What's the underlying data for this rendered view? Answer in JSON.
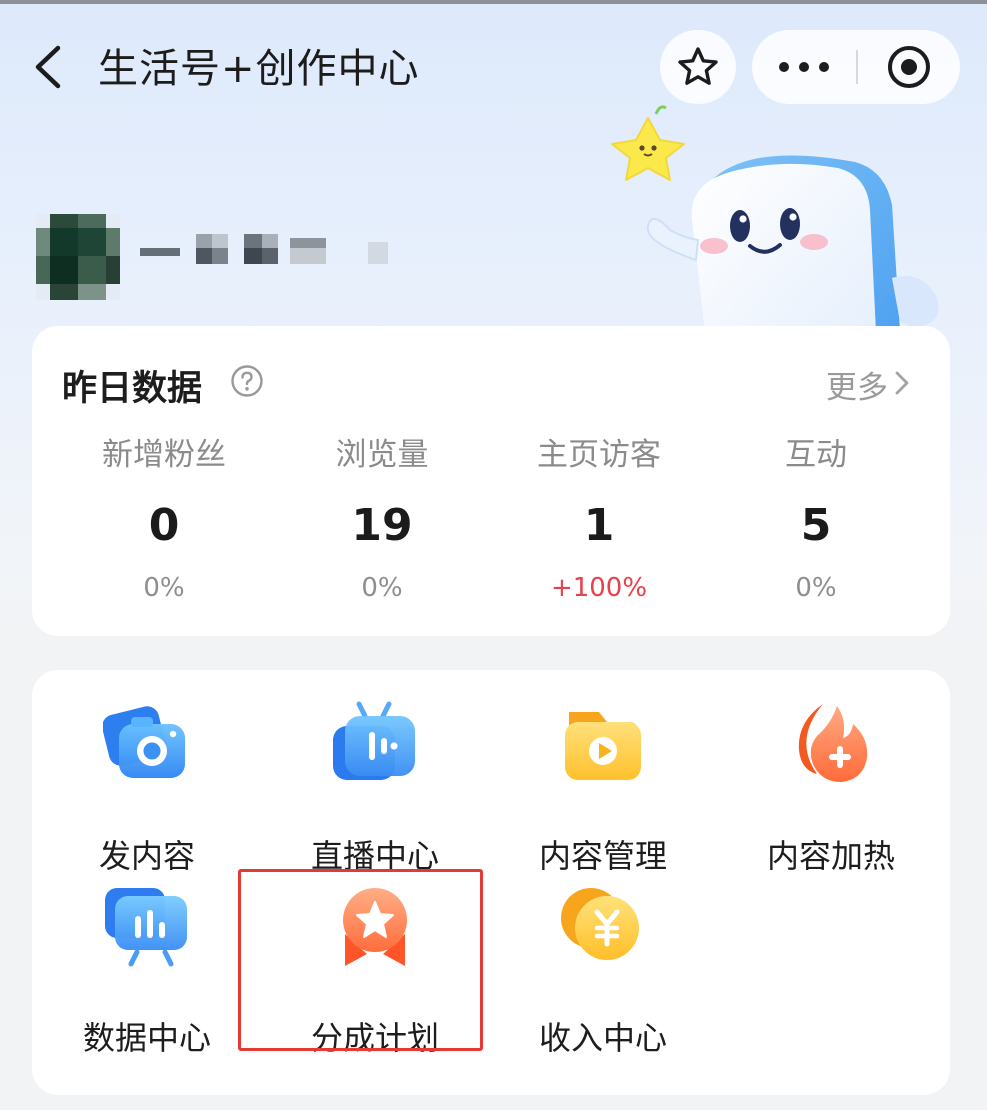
{
  "header": {
    "title": "生活号+创作中心"
  },
  "profile": {
    "name": "一"
  },
  "stats": {
    "title": "昨日数据",
    "more": "更多",
    "items": [
      {
        "label": "新增粉丝",
        "value": "0",
        "change": "0%"
      },
      {
        "label": "浏览量",
        "value": "19",
        "change": "0%"
      },
      {
        "label": "主页访客",
        "value": "1",
        "change": "+100%"
      },
      {
        "label": "互动",
        "value": "5",
        "change": "0%"
      }
    ]
  },
  "tools": [
    {
      "label": "发内容",
      "icon": "camera-icon"
    },
    {
      "label": "直播中心",
      "icon": "live-tv-icon"
    },
    {
      "label": "内容管理",
      "icon": "video-folder-icon"
    },
    {
      "label": "内容加热",
      "icon": "flame-plus-icon"
    },
    {
      "label": "数据中心",
      "icon": "data-chart-icon"
    },
    {
      "label": "分成计划",
      "icon": "medal-icon"
    },
    {
      "label": "收入中心",
      "icon": "yuan-coin-icon"
    }
  ],
  "colors": {
    "accent_red": "#e53935",
    "increase": "#e8414d",
    "hero_bg": "#dde9fb"
  }
}
